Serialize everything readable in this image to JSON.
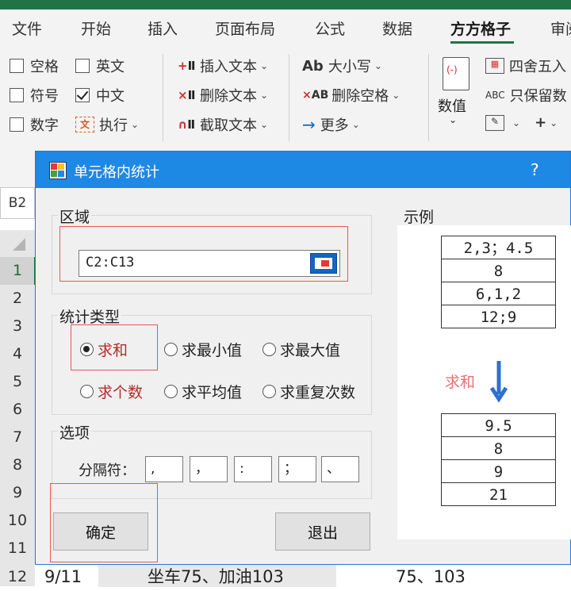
{
  "ribbon": {
    "tabs": [
      "文件",
      "开始",
      "插入",
      "页面布局",
      "公式",
      "数据",
      "方方格子",
      "审阅"
    ],
    "active_tab": "方方格子",
    "checks": [
      {
        "label": "空格",
        "checked": false
      },
      {
        "label": "英文",
        "checked": false
      },
      {
        "label": "符号",
        "checked": false
      },
      {
        "label": "中文",
        "checked": true
      },
      {
        "label": "数字",
        "checked": false
      }
    ],
    "execute_label": "执行",
    "insert_text": "插入文本",
    "delete_text": "删除文本",
    "extract_text": "截取文本",
    "case_label": "大小写",
    "delete_spaces": "删除空格",
    "more_label": "更多",
    "numeric_label": "数值",
    "round_label": "四舍五入",
    "keep_numbers": "只保留数",
    "ab_glyph": "Ab",
    "abc_glyph": "ABC"
  },
  "sheet": {
    "namebox": "B2",
    "row_numbers": [
      "1",
      "2",
      "3",
      "4",
      "5",
      "6",
      "7",
      "8",
      "9",
      "10",
      "11",
      "12"
    ],
    "row12": {
      "date": "9/11",
      "text": "坐车75、加油103",
      "result": "75、103"
    }
  },
  "dialog": {
    "title": "单元格内统计",
    "help": "?",
    "range_label": "区域",
    "range_value": "C2:C13",
    "stat_label": "统计类型",
    "options_label": "选项",
    "separator_label": "分隔符：",
    "separators": [
      ",",
      "，",
      ":",
      "；",
      "、"
    ],
    "radios": [
      {
        "label": "求和",
        "selected": true
      },
      {
        "label": "求最小值",
        "selected": false
      },
      {
        "label": "求最大值",
        "selected": false
      },
      {
        "label": "求个数",
        "selected": false
      },
      {
        "label": "求平均值",
        "selected": false
      },
      {
        "label": "求重复次数",
        "selected": false
      }
    ],
    "ok_button": "确定",
    "exit_button": "退出",
    "example": {
      "label": "示例",
      "input": [
        "2,3；4.5",
        "8",
        "6,1,2",
        "12;9"
      ],
      "arrow_label": "求和",
      "output": [
        "9.5",
        "8",
        "9",
        "21"
      ]
    }
  },
  "colors": {
    "excel_green": "#217346",
    "dialog_blue": "#1e88e5",
    "annotation_red": "#e05a5a"
  }
}
